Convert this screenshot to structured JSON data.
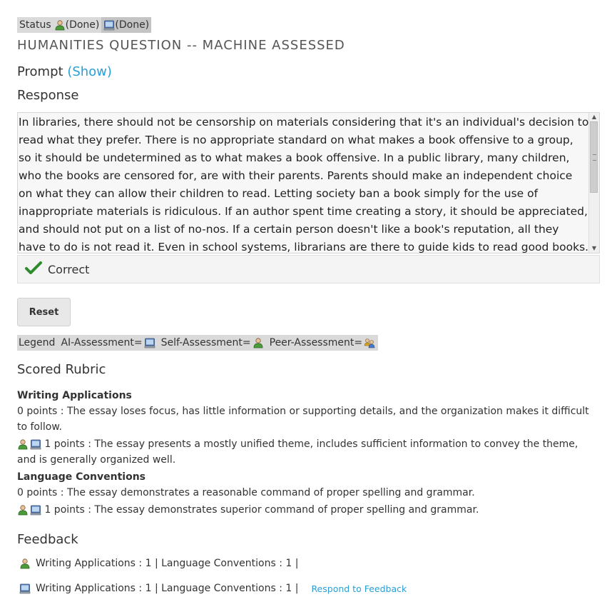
{
  "status": {
    "label": "Status",
    "self_state": "(Done)",
    "ai_state": "(Done)"
  },
  "title": "HUMANITIES QUESTION -- MACHINE ASSESSED",
  "prompt": {
    "label": "Prompt",
    "show_link": "(Show)"
  },
  "response": {
    "heading": "Response",
    "text": "In libraries, there should not be censorship on materials considering that it's an individual's decision to read what they prefer. There is no appropriate standard on what makes a book offensive to a group, so it should be undetermined as to what makes a book offensive. In a public library, many children, who the books are censored for, are with their parents. Parents should make an independent choice on what they can allow their children to read. Letting society ban a book simply for the use of inappropriate materials is ridiculous. If an author spent time creating a story, it should be appreciated, and should not put on a list of no-nos. If a certain person doesn't like a book's reputation, all they have to do is not read it. Even in school systems, librarians are there to guide kids to read good books. If a child wants to read an",
    "result": "Correct"
  },
  "reset_label": "Reset",
  "legend": {
    "label": "Legend",
    "ai": "AI-Assessment=",
    "self": "Self-Assessment=",
    "peer": "Peer-Assessment="
  },
  "rubric": {
    "heading": "Scored Rubric",
    "criteria": [
      {
        "name": "Writing Applications",
        "options": [
          {
            "text": "0 points : The essay loses focus, has little information or supporting details, and the organization makes it difficult to follow."
          },
          {
            "text": "1 points : The essay presents a mostly unified theme, includes sufficient information to convey the theme, and is generally organized well."
          }
        ]
      },
      {
        "name": "Language Conventions",
        "options": [
          {
            "text": "0 points : The essay demonstrates a reasonable command of proper spelling and grammar."
          },
          {
            "text": "1 points : The essay demonstrates superior command of proper spelling and grammar."
          }
        ]
      }
    ]
  },
  "feedback": {
    "heading": "Feedback",
    "self_line": "Writing Applications : 1 | Language Conventions : 1 |",
    "ai_line": "Writing Applications : 1 | Language Conventions : 1 |",
    "respond_link": "Respond to Feedback"
  },
  "colors": {
    "link": "#2a9fd6",
    "check": "#2e8b2e"
  },
  "icons": {
    "self": "person-icon",
    "ai": "computer-icon",
    "peer": "group-icon",
    "correct": "checkmark-icon"
  }
}
